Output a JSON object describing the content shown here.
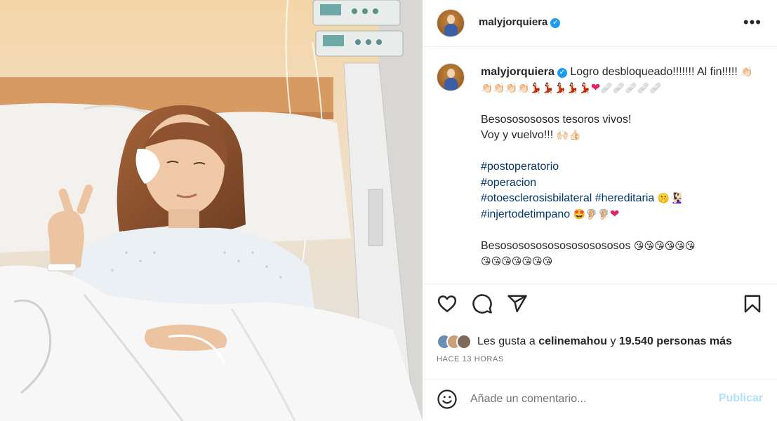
{
  "post": {
    "username": "malyjorquiera",
    "verified_mark": "✓",
    "more_glyph": "•••"
  },
  "caption": {
    "username": "malyjorquiera",
    "line1_text": "Logro desbloqueado!!!!!!! Al fin!!!!!",
    "line1_emojis": "👏🏻👏🏻👏🏻👏🏻👏🏻💃🏻💃🏻💃🏻💃🏻💃🏻",
    "line2_emojis": "🩹🩹🩹🩹🩹",
    "line3": "Besososososos tesoros vivos!",
    "line4_text": "Voy y vuelvo!!!",
    "line4_emojis": "🙌🏻👍🏻",
    "hashtags": [
      "#postoperatorio",
      "#operacion",
      "#otoesclerosisbilateral",
      "#hereditaria",
      "#injertodetimpano"
    ],
    "hereditaria_emojis": "🤫🧏🏻‍♀️",
    "injerto_emojis": "🤩🦻🏻🦻🏻",
    "line_kisses_text": "Besososososososososososos",
    "kiss_emojis": "😘😘😘😘😘😘",
    "kiss_emojis_2": "😘😘😘😘😘😘😘"
  },
  "likes": {
    "prefix": "Les gusta a",
    "user": "celinemahou",
    "joiner": "y",
    "count_text": "19.540 personas más"
  },
  "timestamp": "HACE 13 HORAS",
  "comment": {
    "placeholder": "Añade un comentario...",
    "publish_label": "Publicar"
  },
  "icons": {
    "like": "heart-outline-icon",
    "comment": "speech-bubble-icon",
    "share": "paper-plane-icon",
    "save": "bookmark-icon",
    "emoji": "smiley-icon",
    "more": "ellipsis-icon"
  },
  "colors": {
    "hashtag": "#00376b",
    "publish_disabled": "#b2dffc",
    "secondary_text": "#737373",
    "heart_emoji": "#e0245e"
  }
}
